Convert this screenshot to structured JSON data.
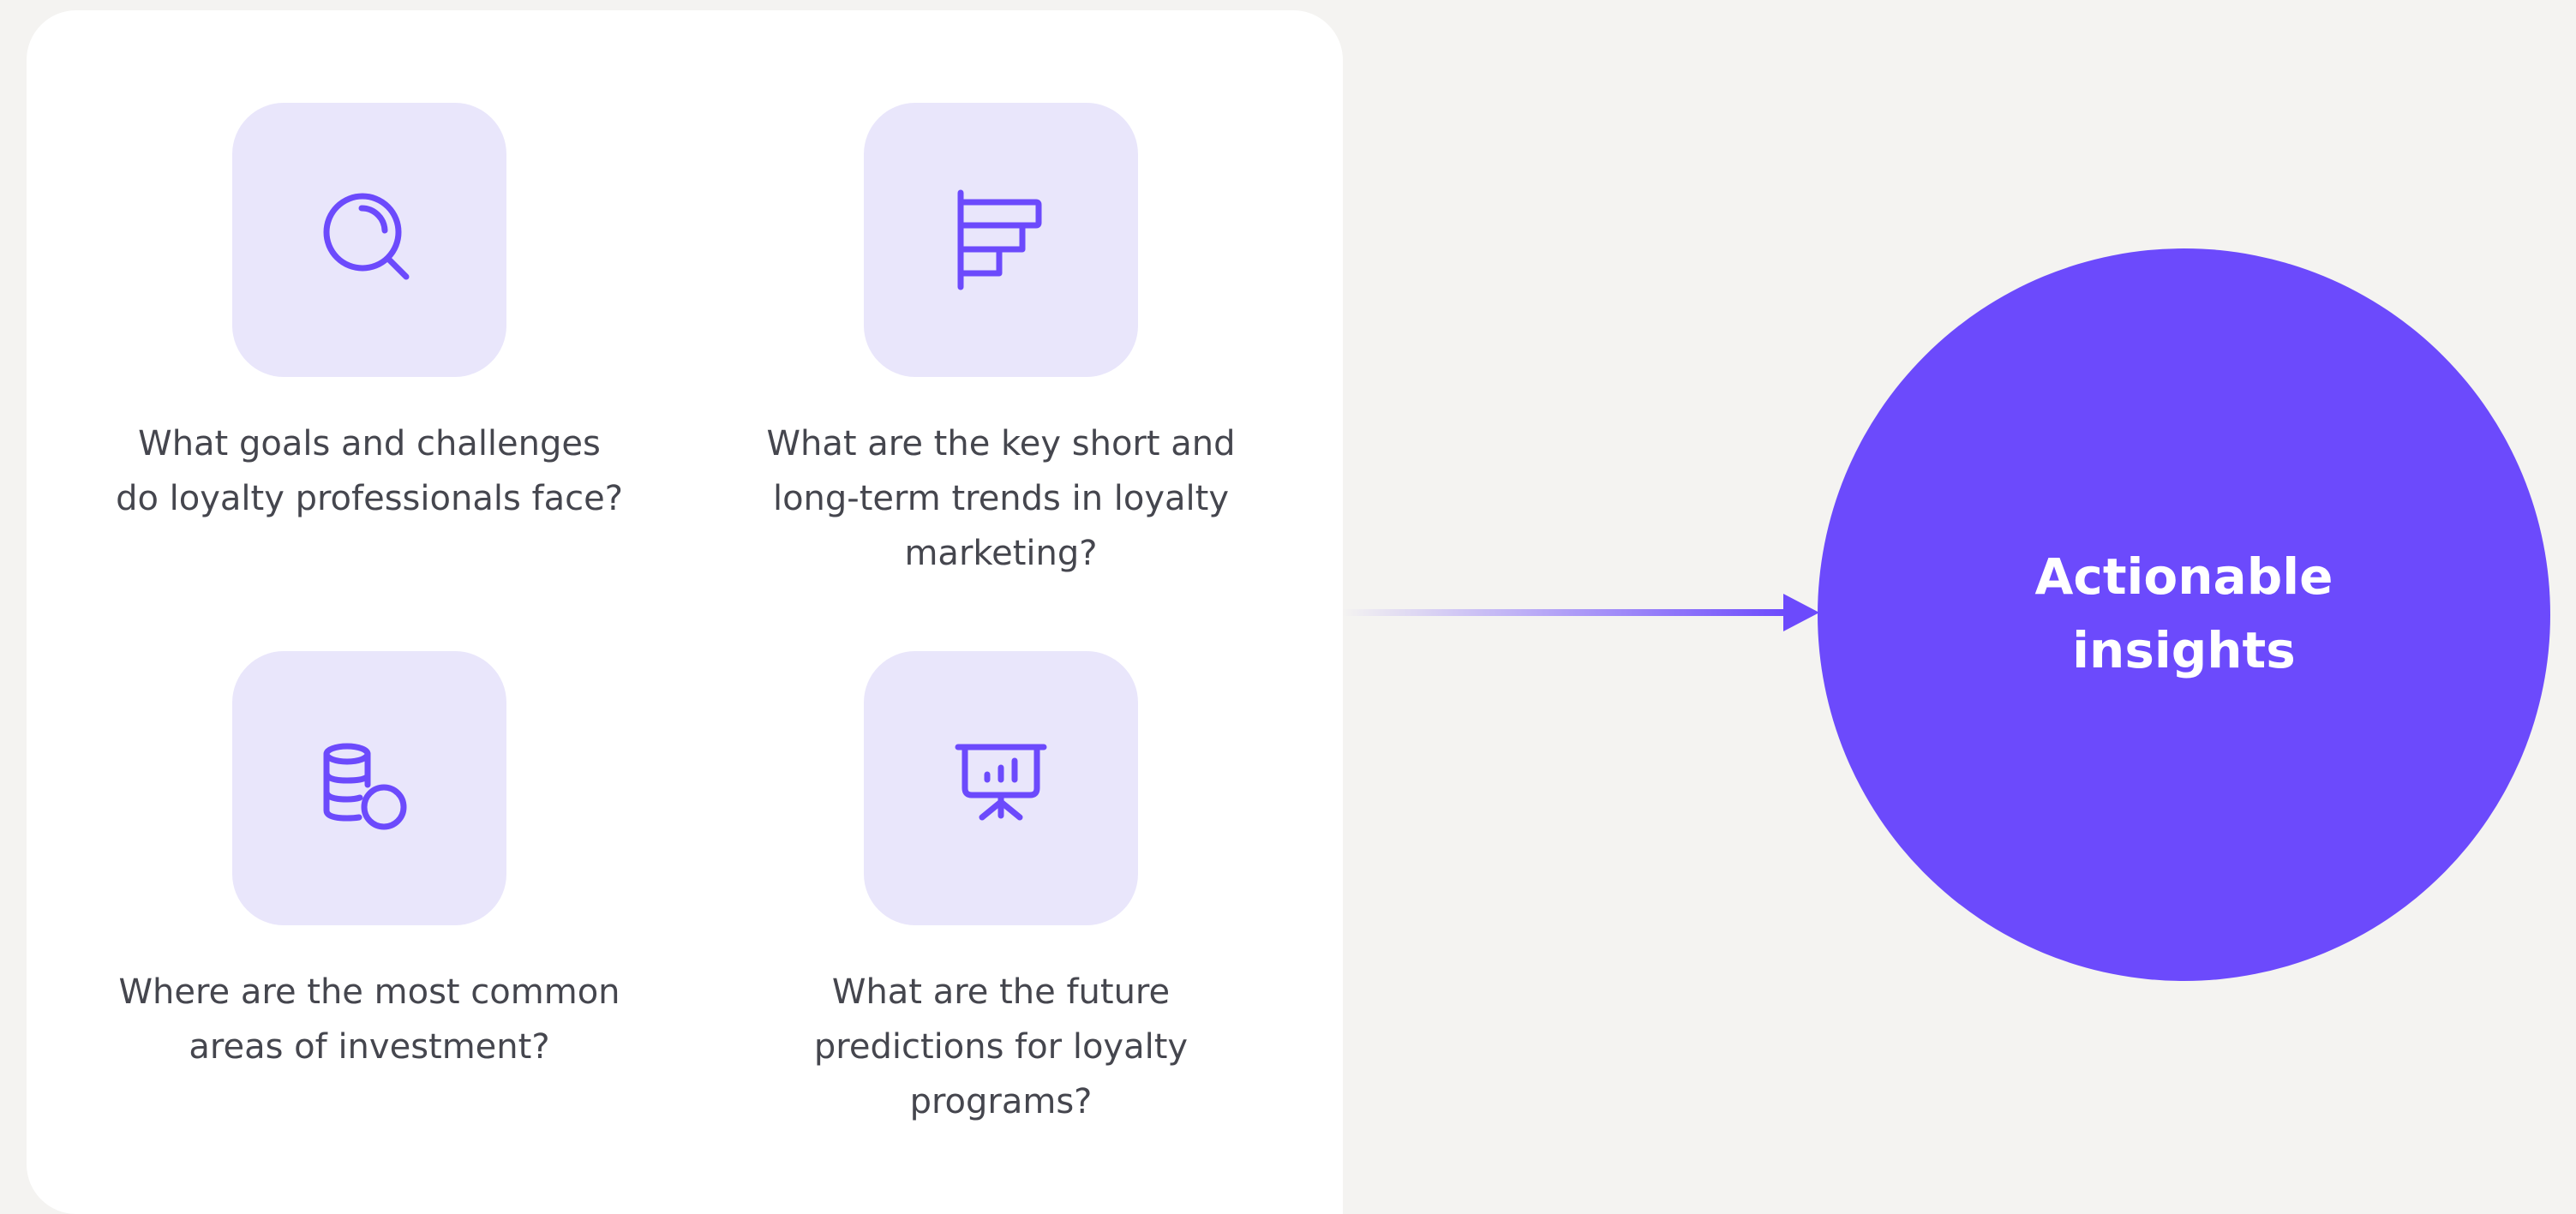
{
  "questions": [
    {
      "icon": "magnifier-icon",
      "text": "What goals and challenges do loyalty professionals face?"
    },
    {
      "icon": "bar-chart-icon",
      "text": "What are the key short and long-term trends in loyalty marketing?"
    },
    {
      "icon": "coins-icon",
      "text": "Where are the most common areas of investment?"
    },
    {
      "icon": "presentation-chart-icon",
      "text": "What are the future predictions for loyalty programs?"
    }
  ],
  "result": {
    "label": "Actionable insights"
  },
  "colors": {
    "accent": "#6c4afc",
    "tile": "#e9e6fb",
    "text": "#45464e",
    "background": "#f4f3f1",
    "panel": "#ffffff"
  }
}
